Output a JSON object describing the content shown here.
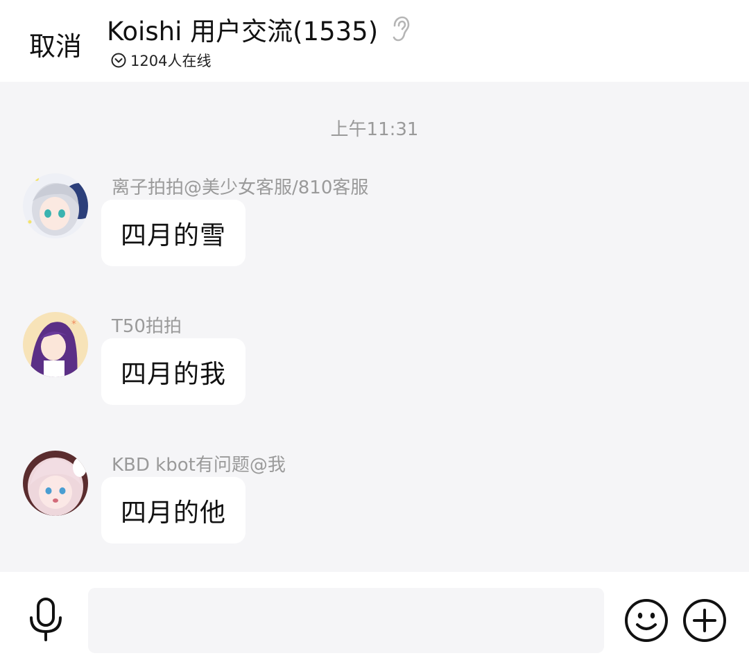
{
  "header": {
    "cancel_label": "取消",
    "group_title": "Koishi 用户交流(1535)",
    "online_text": "1204人在线"
  },
  "chat": {
    "time_label": "上午11:31",
    "messages": [
      {
        "sender": "离子拍拍@美少女客服/810客服",
        "text": "四月的雪",
        "avatar": "avatar-silver-hair-girl"
      },
      {
        "sender": "T50拍拍",
        "text": "四月的我",
        "avatar": "avatar-purple-hair-girl"
      },
      {
        "sender": "KBD kbot有问题@我",
        "text": "四月的他",
        "avatar": "avatar-pink-hair-girl"
      }
    ]
  },
  "input": {
    "value": "",
    "placeholder": ""
  },
  "icons": {
    "ear": "ear-icon",
    "online": "chevron-down-circle-icon",
    "mic": "microphone-icon",
    "emoji": "smiley-icon",
    "plus": "plus-circle-icon"
  },
  "colors": {
    "background": "#f5f5f7",
    "bubble": "#ffffff",
    "muted_text": "#9a9a9a"
  }
}
